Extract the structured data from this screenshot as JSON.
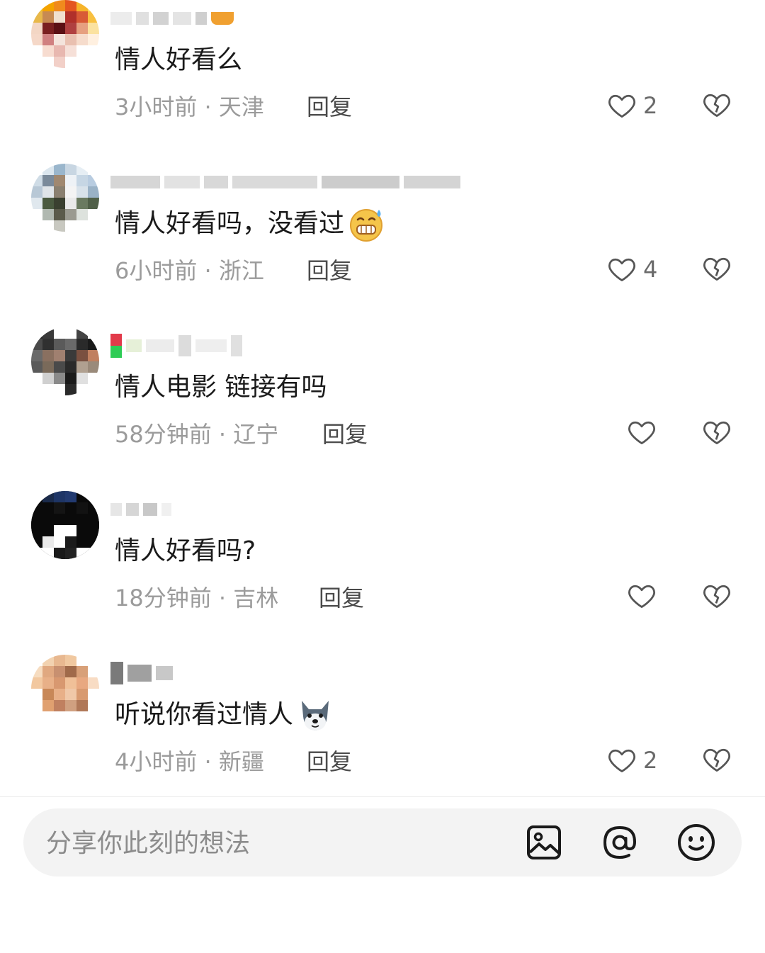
{
  "comments": [
    {
      "text": "情人好看么",
      "time": "3小时前",
      "location": "天津",
      "reply_label": "回复",
      "likes": "2"
    },
    {
      "text": "情人好看吗，没看过",
      "time": "6小时前",
      "location": "浙江",
      "reply_label": "回复",
      "likes": "4"
    },
    {
      "text": "情人电影 链接有吗",
      "time": "58分钟前",
      "location": "辽宁",
      "reply_label": "回复",
      "likes": ""
    },
    {
      "text": "情人好看吗?",
      "time": "18分钟前",
      "location": "吉林",
      "reply_label": "回复",
      "likes": ""
    },
    {
      "text": "听说你看过情人",
      "time": "4小时前",
      "location": "新疆",
      "reply_label": "回复",
      "likes": "2"
    }
  ],
  "input": {
    "placeholder": "分享你此刻的想法"
  },
  "icons": {
    "like": "heart-outline-icon",
    "dislike": "broken-heart-icon",
    "image": "image-icon",
    "mention": "at-icon",
    "emoji": "smiley-icon"
  }
}
